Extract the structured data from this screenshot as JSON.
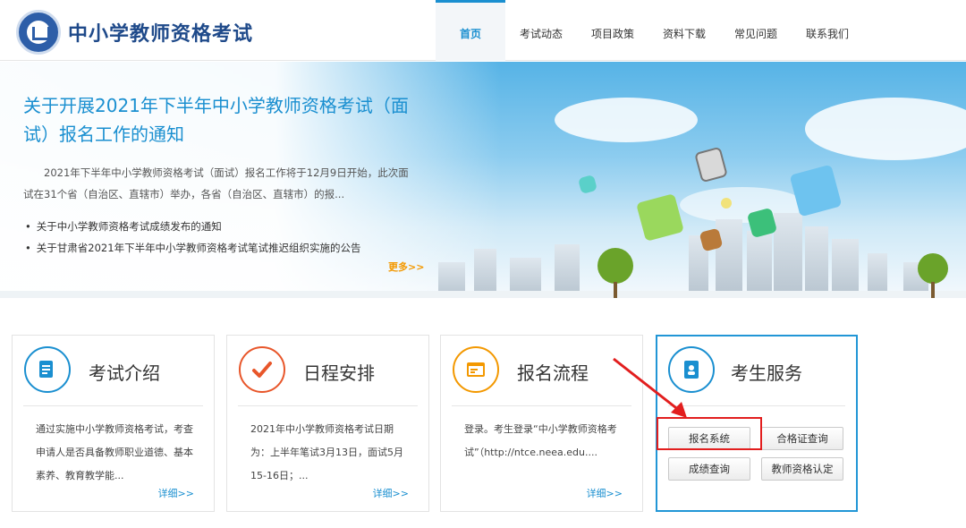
{
  "header": {
    "site_title": "中小学教师资格考试",
    "nav": [
      "首页",
      "考试动态",
      "项目政策",
      "资料下载",
      "常见问题",
      "联系我们"
    ]
  },
  "banner": {
    "title": "关于开展2021年下半年中小学教师资格考试（面试）报名工作的通知",
    "summary": "2021年下半年中小学教师资格考试（面试）报名工作将于12月9日开始，此次面试在31个省（自治区、直辖市）举办，各省（自治区、直辖市）的报...",
    "links": [
      "关于中小学教师资格考试成绩发布的通知",
      "关于甘肃省2021年下半年中小学教师资格考试笔试推迟组织实施的公告"
    ],
    "more": "更多>>"
  },
  "cards": [
    {
      "title": "考试介绍",
      "text": "通过实施中小学教师资格考试，考查申请人是否具备教师职业道德、基本素养、教育教学能...",
      "more": "详细>>",
      "icon": "document-edit-icon",
      "color": "#1a8fd0"
    },
    {
      "title": "日程安排",
      "text": "2021年中小学教师资格考试日期为：上半年笔试3月13日，面试5月15-16日；...",
      "more": "详细>>",
      "icon": "checkmark-icon",
      "color": "#e8562a"
    },
    {
      "title": "报名流程",
      "text": "登录。考生登录“中小学教师资格考试”（http://ntce.neea.edu....",
      "more": "详细>>",
      "icon": "browser-window-icon",
      "color": "#f39800"
    }
  ],
  "service": {
    "title": "考生服务",
    "icon": "contacts-book-icon",
    "buttons": [
      "报名系统",
      "合格证查询",
      "成绩查询",
      "教师资格认定"
    ]
  },
  "colors": {
    "accent": "#1a8fd0",
    "highlight": "#e21e1e",
    "brand": "#1f4a8a"
  }
}
